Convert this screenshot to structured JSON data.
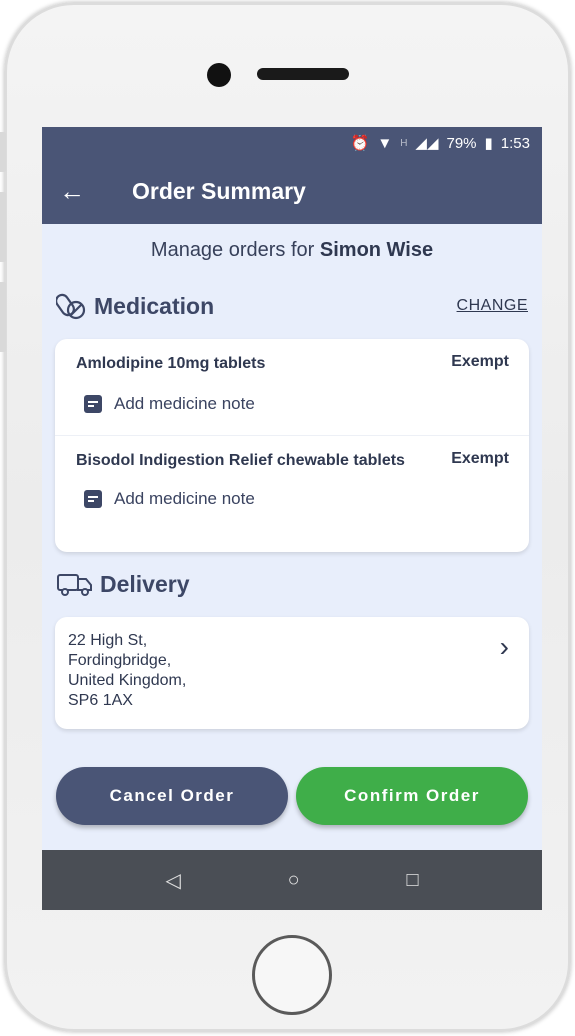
{
  "status_bar": {
    "battery": "79%",
    "time": "1:53",
    "signal_label": "H"
  },
  "app_bar": {
    "title": "Order Summary",
    "back_icon": "arrow-left-icon"
  },
  "header": {
    "manage_prefix": "Manage orders for ",
    "patient_name": "Simon Wise"
  },
  "medication": {
    "section_title": "Medication",
    "change_label": "CHANGE",
    "items": [
      {
        "name": "Amlodipine 10mg tablets",
        "status": "Exempt",
        "note_label": "Add medicine note"
      },
      {
        "name": "Bisodol Indigestion Relief chewable tablets",
        "status": "Exempt",
        "note_label": "Add medicine note"
      }
    ]
  },
  "delivery": {
    "section_title": "Delivery",
    "address_lines": [
      "22 High St,",
      "Fordingbridge,",
      "United Kingdom,",
      "SP6 1AX"
    ]
  },
  "actions": {
    "cancel_label": "Cancel Order",
    "confirm_label": "Confirm Order"
  },
  "colors": {
    "primary": "#4a5576",
    "confirm": "#3fae49",
    "background": "#e8eefb"
  }
}
